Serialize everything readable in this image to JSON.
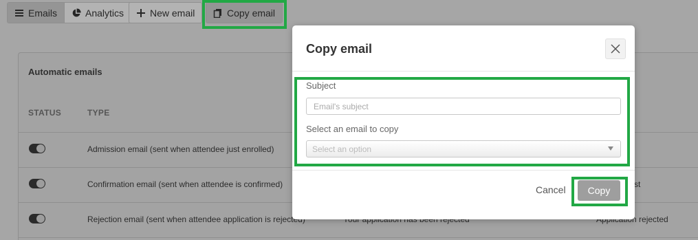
{
  "toolbar": {
    "emails_label": "Emails",
    "analytics_label": "Analytics",
    "new_email_label": "New email",
    "copy_email_label": "Copy email"
  },
  "panel": {
    "title": "Automatic emails",
    "columns": {
      "status": "STATUS",
      "type": "TYPE"
    },
    "rows": [
      {
        "type": "Admission email (sent when attendee just enrolled)",
        "subject": "",
        "name": ""
      },
      {
        "type": "Confirmation email (sent when attendee is confirmed)",
        "subject": "",
        "name": "st"
      },
      {
        "type": "Rejection email (sent when attendee application is rejected)",
        "subject": "Your application has been rejected",
        "name": "Application rejected"
      }
    ]
  },
  "modal": {
    "title": "Copy email",
    "subject_label": "Subject",
    "subject_placeholder": "Email's subject",
    "select_label": "Select an email to copy",
    "select_placeholder": "Select an option",
    "cancel_label": "Cancel",
    "copy_label": "Copy"
  },
  "colors": {
    "highlight": "#22a845",
    "overlay": "#a6a6a6"
  }
}
